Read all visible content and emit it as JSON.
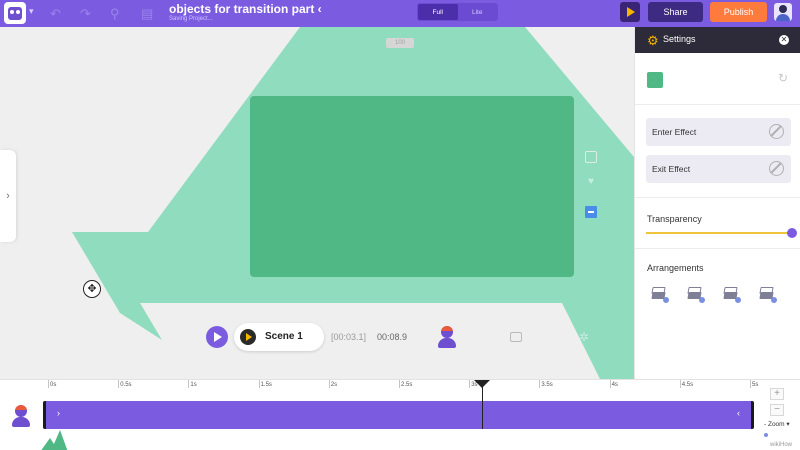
{
  "topbar": {
    "project_title": "objects for transition part ‹",
    "project_status": "Saving Project...",
    "modes": [
      "Full",
      "Lite"
    ],
    "active_mode": "Full",
    "share_label": "Share",
    "publish_label": "Publish",
    "undo_icon": "undo-icon",
    "redo_icon": "redo-icon",
    "search_icon": "search-icon",
    "save_icon": "save-icon",
    "accent_color": "#7b5ce0",
    "publish_color": "#ff7a3d"
  },
  "canvas": {
    "zoom_label": "100",
    "shape_color_light": "#8fdcbf",
    "shape_color_dark": "#4fb885",
    "left_panel_toggle": "›"
  },
  "scene_bar": {
    "scene_name": "Scene 1",
    "current_time": "[00:03.1]",
    "total_time": "00:08.9"
  },
  "settings": {
    "title": "Settings",
    "close_label": "✕",
    "color_value": "#4fb885",
    "enter_effect_label": "Enter Effect",
    "exit_effect_label": "Exit Effect",
    "transparency_label": "Transparency",
    "transparency_value": 1.0,
    "arrangements_label": "Arrangements",
    "arrangement_icons": [
      "bring-to-front-icon",
      "bring-forward-icon",
      "send-backward-icon",
      "send-to-back-icon"
    ]
  },
  "timeline": {
    "ticks": [
      "0s",
      "0.5s",
      "1s",
      "1.5s",
      "2s",
      "2.5s",
      "3s",
      "3.5s",
      "4s",
      "4.5s",
      "5s"
    ],
    "playhead_time": "3.1s",
    "zoom_in_label": "+",
    "zoom_out_label": "−",
    "zoom_label": "- Zoom ▾",
    "watermark": "wikiHow"
  }
}
